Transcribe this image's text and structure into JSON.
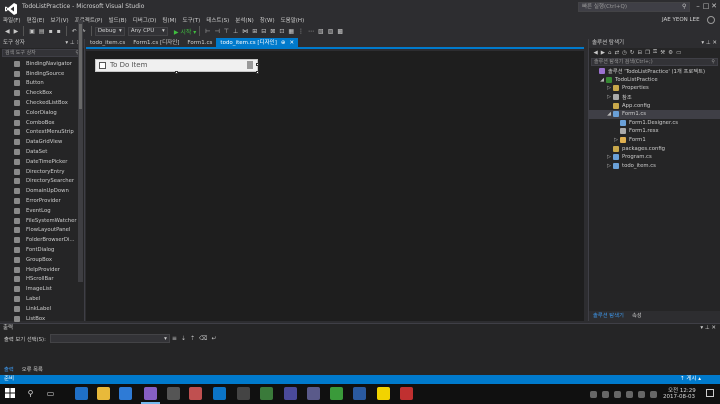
{
  "window": {
    "title": "TodoListPractice - Microsoft Visual Studio",
    "quick_launch_placeholder": "빠른 실행(Ctrl+Q)",
    "user": "JAE YEON LEE"
  },
  "menu": [
    "파일(F)",
    "편집(E)",
    "보기(V)",
    "프로젝트(P)",
    "빌드(B)",
    "디버그(D)",
    "팀(M)",
    "도구(T)",
    "테스트(S)",
    "분석(N)",
    "창(W)",
    "도움말(H)"
  ],
  "toolbar": {
    "config": "Debug",
    "platform": "Any CPU",
    "start_label": "▶ 시작 ▾"
  },
  "toolbox": {
    "title": "도구 상자",
    "search_placeholder": "검색 도구 상자",
    "pointer": "포인터",
    "items": [
      "BindingNavigator",
      "BindingSource",
      "Button",
      "CheckBox",
      "CheckedListBox",
      "ColorDialog",
      "ComboBox",
      "ContextMenuStrip",
      "DataGridView",
      "DataSet",
      "DateTimePicker",
      "DirectoryEntry",
      "DirectorySearcher",
      "DomainUpDown",
      "ErrorProvider",
      "EventLog",
      "FileSystemWatcher",
      "FlowLayoutPanel",
      "FolderBrowserDi...",
      "FontDialog",
      "GroupBox",
      "HelpProvider",
      "HScrollBar",
      "ImageList",
      "Label",
      "LinkLabel",
      "ListBox"
    ]
  },
  "doc_tabs": [
    {
      "label": "todo_item.cs",
      "active": false
    },
    {
      "label": "Form1.cs [디자인]",
      "active": false
    },
    {
      "label": "Form1.cs",
      "active": false
    },
    {
      "label": "todo_item.cs [디자인]",
      "active": true
    }
  ],
  "designer": {
    "item_text": "To Do Item"
  },
  "solution": {
    "title": "솔루션 탐색기",
    "search_placeholder": "솔루션 탐색기 검색(Ctrl+;)",
    "nodes": [
      {
        "label": "솔루션 'TodoListPractice' (1개 프로젝트)",
        "indent": 0,
        "arrow": "",
        "icon": "#9b72cf"
      },
      {
        "label": "TodoListPractice",
        "indent": 1,
        "arrow": "◢",
        "icon": "#388a34"
      },
      {
        "label": "Properties",
        "indent": 2,
        "arrow": "▷",
        "icon": "#c8a84b"
      },
      {
        "label": "참조",
        "indent": 2,
        "arrow": "▷",
        "icon": "#aaaaaa"
      },
      {
        "label": "App.config",
        "indent": 2,
        "arrow": "",
        "icon": "#c8a84b"
      },
      {
        "label": "Form1.cs",
        "indent": 2,
        "arrow": "◢",
        "icon": "#6aa0d8"
      },
      {
        "label": "Form1.Designer.cs",
        "indent": 3,
        "arrow": "",
        "icon": "#6aa0d8"
      },
      {
        "label": "Form1.resx",
        "indent": 3,
        "arrow": "",
        "icon": "#aaaaaa"
      },
      {
        "label": "Form1",
        "indent": 3,
        "arrow": "▷",
        "icon": "#e0b050"
      },
      {
        "label": "packages.config",
        "indent": 2,
        "arrow": "",
        "icon": "#c8a84b"
      },
      {
        "label": "Program.cs",
        "indent": 2,
        "arrow": "▷",
        "icon": "#6aa0d8"
      },
      {
        "label": "todo_item.cs",
        "indent": 2,
        "arrow": "▷",
        "icon": "#6aa0d8"
      }
    ],
    "bottom_tabs": [
      "솔루션 탐색기",
      "속성"
    ]
  },
  "output": {
    "title": "출력",
    "source_label": "출력 보기 선택(S):",
    "tabs": [
      "출력",
      "오류 목록"
    ]
  },
  "status": {
    "text": "준비",
    "right": "↑ 게시 ▴"
  },
  "taskbar": {
    "time": "오전 12:29",
    "date": "2017-08-03"
  }
}
